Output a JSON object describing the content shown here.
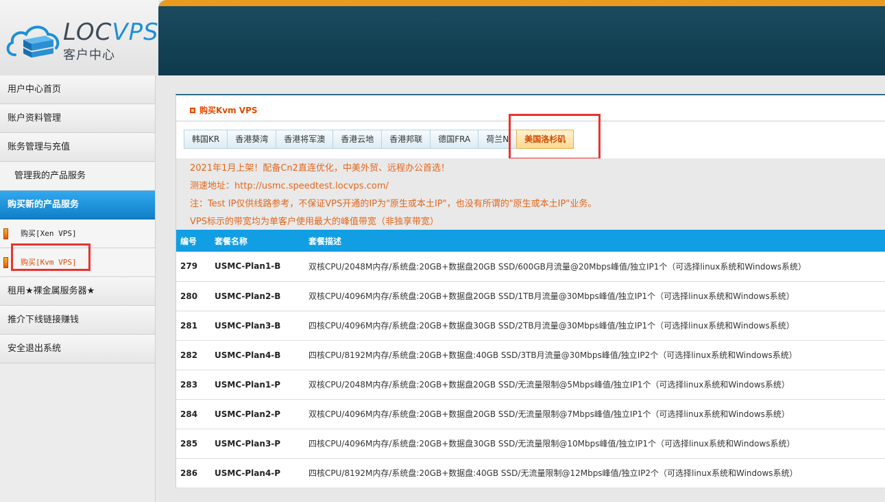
{
  "logo": {
    "text_loc": "LOC",
    "text_vps": "VPS",
    "subtitle": "客户中心"
  },
  "sidebar": {
    "items": [
      {
        "label": "用户中心首页"
      },
      {
        "label": "账户资料管理"
      },
      {
        "label": "账务管理与充值"
      },
      {
        "label": "管理我的产品服务"
      },
      {
        "label": "购买新的产品服务"
      },
      {
        "label": "购买[Xen VPS]"
      },
      {
        "label": "购买[Kvm VPS]"
      },
      {
        "label": "租用★裸金属服务器★"
      },
      {
        "label": "推介下线链接赚钱"
      },
      {
        "label": "安全退出系统"
      }
    ]
  },
  "panel": {
    "title": "购买Kvm VPS",
    "tabs": [
      "韩国KR",
      "香港葵湾",
      "香港将军澳",
      "香港云地",
      "香港邦联",
      "德国FRA",
      "荷兰N",
      "美国洛杉矶"
    ],
    "active_tab": "美国洛杉矶",
    "notices": [
      "2021年1月上架！配备Cn2直连优化，中美外贸、远程办公首选！",
      "测速地址：http://usmc.speedtest.locvps.com/",
      "注：Test IP仅供线路参考，不保证VPS开通的IP为\"原生或本土IP\"，也没有所谓的\"原生或本土IP\"业务。",
      "VPS标示的带宽均为单客户使用最大的峰值带宽（非独享带宽）"
    ],
    "table": {
      "headers": [
        "编号",
        "套餐名称",
        "套餐描述"
      ],
      "rows": [
        {
          "id": "279",
          "name": "USMC-Plan1-B",
          "desc": "双核CPU/2048M内存/系统盘:20GB+数据盘20GB SSD/600GB月流量@20Mbps峰值/独立IP1个（可选择linux系统和Windows系统）"
        },
        {
          "id": "280",
          "name": "USMC-Plan2-B",
          "desc": "双核CPU/4096M内存/系统盘:20GB+数据盘20GB SSD/1TB月流量@30Mbps峰值/独立IP1个（可选择linux系统和Windows系统）"
        },
        {
          "id": "281",
          "name": "USMC-Plan3-B",
          "desc": "四核CPU/4096M内存/系统盘:20GB+数据盘30GB SSD/2TB月流量@30Mbps峰值/独立IP1个（可选择linux系统和Windows系统）"
        },
        {
          "id": "282",
          "name": "USMC-Plan4-B",
          "desc": "四核CPU/8192M内存/系统盘:20GB+数据盘:40GB SSD/3TB月流量@30Mbps峰值/独立IP2个（可选择linux系统和Windows系统）"
        },
        {
          "id": "283",
          "name": "USMC-Plan1-P",
          "desc": "双核CPU/2048M内存/系统盘:20GB+数据盘20GB SSD/无流量限制@5Mbps峰值/独立IP1个（可选择linux系统和Windows系统）"
        },
        {
          "id": "284",
          "name": "USMC-Plan2-P",
          "desc": "双核CPU/4096M内存/系统盘:20GB+数据盘20GB SSD/无流量限制@7Mbps峰值/独立IP1个（可选择linux系统和Windows系统）"
        },
        {
          "id": "285",
          "name": "USMC-Plan3-P",
          "desc": "四核CPU/4096M内存/系统盘:20GB+数据盘30GB SSD/无流量限制@10Mbps峰值/独立IP1个（可选择linux系统和Windows系统）"
        },
        {
          "id": "286",
          "name": "USMC-Plan4-P",
          "desc": "四核CPU/8192M内存/系统盘:20GB+数据盘:40GB SSD/无流量限制@12Mbps峰值/独立IP2个（可选择linux系统和Windows系统）"
        }
      ]
    }
  },
  "colors": {
    "accent_blue": "#119ee3",
    "header_dark": "#0e3a4c",
    "header_orange": "#e99a1f",
    "notice_orange": "#e2661c",
    "highlight_red": "#e8322f"
  }
}
